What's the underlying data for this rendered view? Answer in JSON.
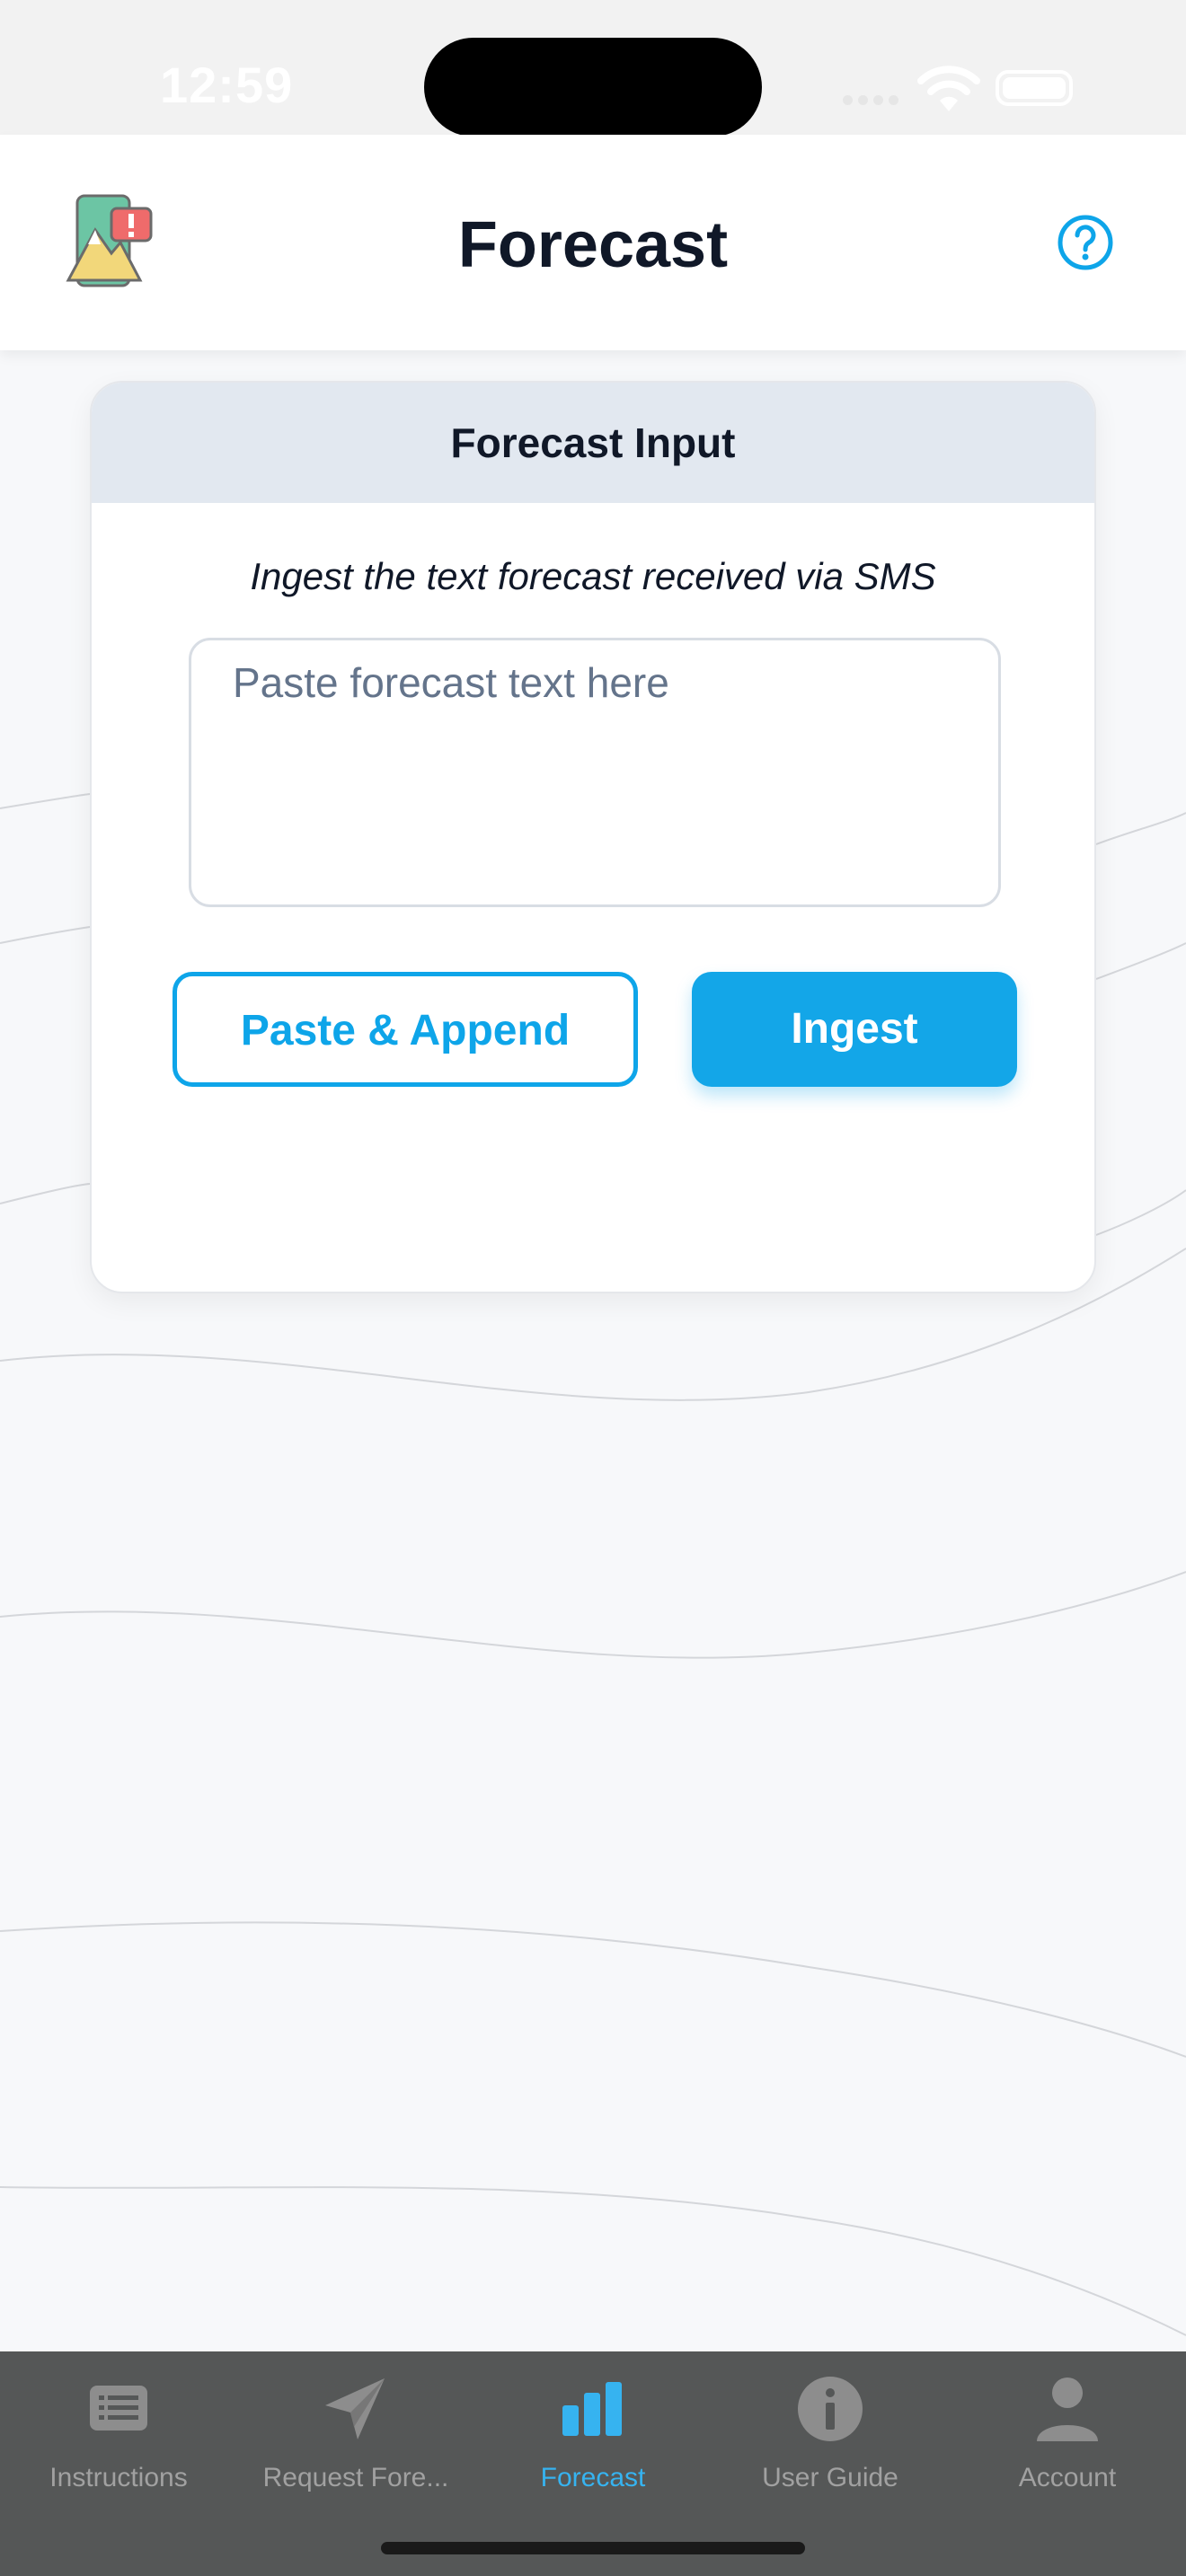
{
  "status_bar": {
    "time": "12:59"
  },
  "header": {
    "title": "Forecast",
    "logo_icon": "mountain-alert-phone-icon",
    "help_icon": "help-circle-icon"
  },
  "card": {
    "title": "Forecast Input",
    "subtitle": "Ingest the text forecast received via SMS",
    "input": {
      "placeholder": "Paste forecast text here",
      "value": ""
    },
    "paste_button_label": "Paste & Append",
    "ingest_button_label": "Ingest"
  },
  "tabs": [
    {
      "label": "Instructions",
      "icon": "list-icon",
      "active": false
    },
    {
      "label": "Request Fore...",
      "icon": "paper-plane-icon",
      "active": false
    },
    {
      "label": "Forecast",
      "icon": "bar-chart-icon",
      "active": true
    },
    {
      "label": "User Guide",
      "icon": "info-icon",
      "active": false
    },
    {
      "label": "Account",
      "icon": "person-icon",
      "active": false
    }
  ],
  "colors": {
    "accent": "#13a6e8",
    "tab_bar": "#555757",
    "card_header": "#e2e8f0",
    "text": "#101828"
  }
}
